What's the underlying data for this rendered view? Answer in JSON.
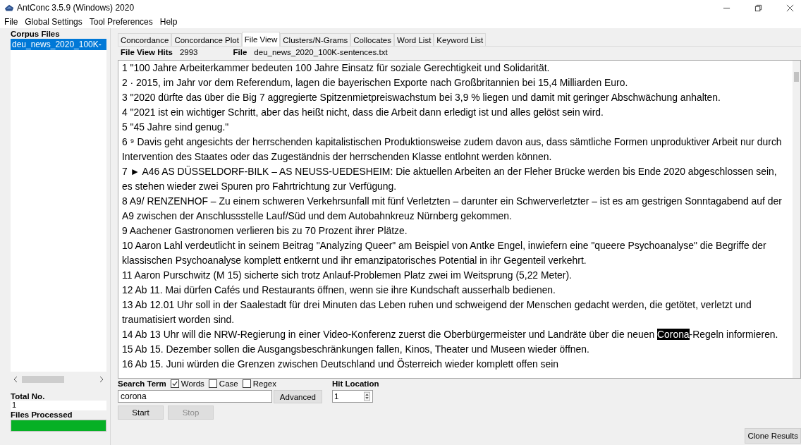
{
  "window": {
    "title": "AntConc 3.5.9 (Windows) 2020"
  },
  "menu": [
    "File",
    "Global Settings",
    "Tool Preferences",
    "Help"
  ],
  "sidebar": {
    "corpus_label": "Corpus Files",
    "files": [
      {
        "name": "deu_news_2020_100K-",
        "selected": true
      }
    ],
    "total_label": "Total No.",
    "total_value": "1",
    "processed_label": "Files Processed",
    "progress": {
      "level": 1
    }
  },
  "tabs": [
    {
      "label": "Concordance",
      "selected": false
    },
    {
      "label": "Concordance Plot",
      "selected": false
    },
    {
      "label": "File View",
      "selected": true
    },
    {
      "label": "Clusters/N-Grams",
      "selected": false
    },
    {
      "label": "Collocates",
      "selected": false
    },
    {
      "label": "Word List",
      "selected": false
    },
    {
      "label": "Keyword List",
      "selected": false
    }
  ],
  "hits": {
    "label": "File View Hits",
    "value": "2993",
    "file_label": "File",
    "file_value": "deu_news_2020_100K-sentences.txt"
  },
  "lines": [
    {
      "segments": [
        {
          "text": "1  \"100 Jahre Arbeiterkammer bedeuten 100 Jahre Einsatz für soziale Gerechtigkeit und Solidarität.",
          "highlight": false
        }
      ]
    },
    {
      "segments": [
        {
          "text": "2  · 2015, im Jahr vor dem Referendum, lagen die bayerischen Exporte nach Großbritannien bei 15,4 Milliarden Euro.",
          "highlight": false
        }
      ]
    },
    {
      "segments": [
        {
          "text": "3  \"2020 dürfte das über die Big 7 aggregierte Spitzenmietpreiswachstum bei 3,9 % liegen und damit mit geringer Abschwächung anhalten.",
          "highlight": false
        }
      ]
    },
    {
      "segments": [
        {
          "text": "4  \"2021 ist ein wichtiger Schritt, aber das heißt nicht, dass die Arbeit dann erledigt ist und alles gelöst sein wird.",
          "highlight": false
        }
      ]
    },
    {
      "segments": [
        {
          "text": "5  \"45 Jahre sind genug.\"",
          "highlight": false
        }
      ]
    },
    {
      "segments": [
        {
          "text": "6  ⁹ Davis geht angesichts der herrschenden kapitalistischen Produktionsweise zudem davon aus, dass sämtliche Formen unproduktiver Arbeit nur durch Intervention des Staates oder das Zugeständnis der herrschenden Klasse entlohnt werden können.",
          "highlight": false
        }
      ]
    },
    {
      "segments": [
        {
          "text": "7  ►     A46 AS DÜSSELDORF-BILK – AS NEUSS-UEDESHEIM: Die aktuellen Arbeiten an der Fleher Brücke werden bis Ende 2020 abgeschlossen sein, es stehen wieder zwei Spuren pro Fahrtrichtung zur Verfügung.",
          "highlight": false
        }
      ]
    },
    {
      "segments": [
        {
          "text": "8  A9/ RENZENHOF – Zu einem schweren Verkehrsunfall mit fünf Verletzten – darunter ein Schwerverletzter – ist es am gestrigen Sonntagabend auf der A9 zwischen der Anschlussstelle Lauf/Süd und dem Autobahnkreuz Nürnberg gekommen.",
          "highlight": false
        }
      ]
    },
    {
      "segments": [
        {
          "text": "9  Aachener Gastronomen verlieren bis zu 70 Prozent ihrer Plätze.",
          "highlight": false
        }
      ]
    },
    {
      "segments": [
        {
          "text": "10 Aaron Lahl verdeutlicht in seinem Beitrag \"Analyzing Queer\" am Beispiel von Antke Engel, inwiefern eine \"queere Psychoanalyse\" die Begriffe der klassischen Psychoanalyse komplett entkernt und ihr emanzipatorisches Potential in ihr Gegenteil verkehrt.",
          "highlight": false
        }
      ]
    },
    {
      "segments": [
        {
          "text": "11 Aaron Purschwitz (M 15) sicherte sich trotz Anlauf-Problemen Platz zwei im Weitsprung (5,22 Meter).",
          "highlight": false
        }
      ]
    },
    {
      "segments": [
        {
          "text": "12 Ab 11. Mai dürfen Cafés und Restaurants öffnen, wenn sie ihre Kundschaft ausserhalb bedienen.",
          "highlight": false
        }
      ]
    },
    {
      "segments": [
        {
          "text": "13 Ab 12.01 Uhr soll in der Saalestadt für drei Minuten das Leben ruhen und schweigend der Menschen gedacht werden, die getötet, verletzt und traumatisiert worden sind.",
          "highlight": false
        }
      ]
    },
    {
      "segments": [
        {
          "text": "14 Ab 13 Uhr will die NRW-Regierung in einer Video-Konferenz zuerst die Oberbürgermeister und Landräte über die neuen ",
          "highlight": false
        },
        {
          "text": "Corona",
          "highlight": true
        },
        {
          "text": "-Regeln informieren.",
          "highlight": false
        }
      ]
    },
    {
      "segments": [
        {
          "text": "15 Ab 15. Dezember sollen die Ausgangsbeschränkungen fallen, Kinos, Theater und Museen wieder öffnen.",
          "highlight": false
        }
      ]
    },
    {
      "segments": [
        {
          "text": "16 Ab 15. Juni würden die Grenzen zwischen Deutschland und Österreich wieder komplett offen sein",
          "highlight": false
        }
      ]
    }
  ],
  "search": {
    "label": "Search Term",
    "options": [
      {
        "label": "Words",
        "checked": true
      },
      {
        "label": "Case",
        "checked": false
      },
      {
        "label": "Regex",
        "checked": false
      }
    ],
    "value": "corona",
    "advanced": "Advanced",
    "hit_location_label": "Hit Location",
    "hit_location": "1",
    "start": "Start",
    "stop": "Stop",
    "stop_disabled": true
  },
  "clone_button": "Clone Results"
}
